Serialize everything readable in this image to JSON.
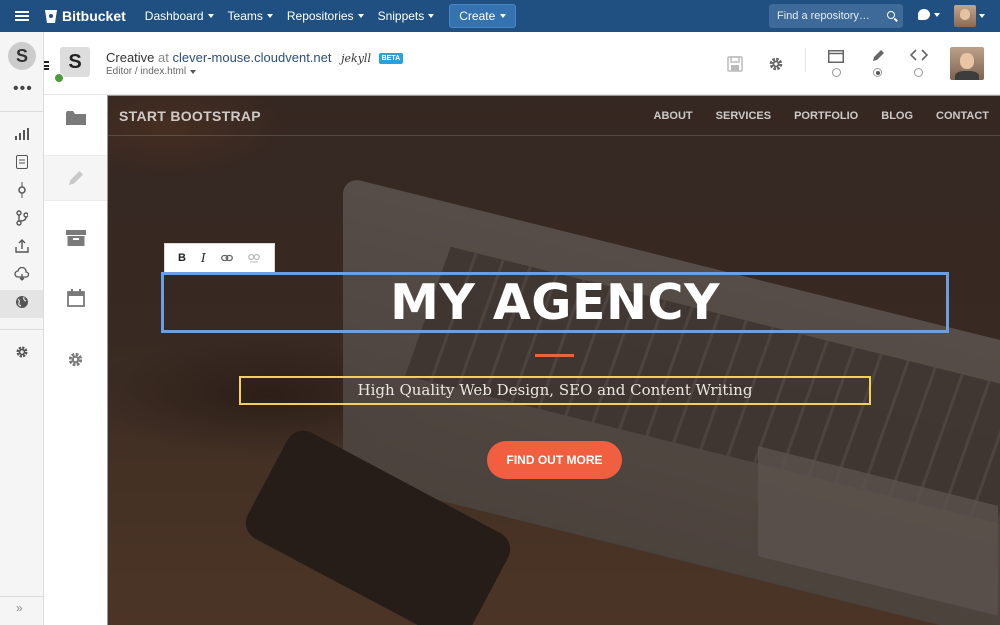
{
  "topbar": {
    "brand": "Bitbucket",
    "nav": [
      {
        "label": "Dashboard"
      },
      {
        "label": "Teams"
      },
      {
        "label": "Repositories"
      },
      {
        "label": "Snippets"
      }
    ],
    "create_label": "Create",
    "search_placeholder": "Find a repository…"
  },
  "rail": {
    "logo_glyph": "S",
    "more_glyph": "•••",
    "expand_glyph": "»"
  },
  "editor": {
    "logo_glyph": "S",
    "site_name": "Creative",
    "at_text": "at",
    "host": "clever-mouse.cloudvent.net",
    "engine": "jekyll",
    "beta": "BETA",
    "path": "Editor / index.html"
  },
  "site": {
    "brand": "START BOOTSTRAP",
    "links": [
      "ABOUT",
      "SERVICES",
      "PORTFOLIO",
      "BLOG",
      "CONTACT"
    ],
    "format": {
      "bold": "B",
      "italic": "I"
    },
    "heading": "MY AGENCY",
    "subheading": "High Quality Web Design, SEO and Content Writing",
    "cta": "FIND OUT MORE"
  },
  "colors": {
    "topbar": "#205081",
    "accent": "#f05f40",
    "heading_outline": "#6f9ee0",
    "subheading_outline": "#f2d15b"
  }
}
